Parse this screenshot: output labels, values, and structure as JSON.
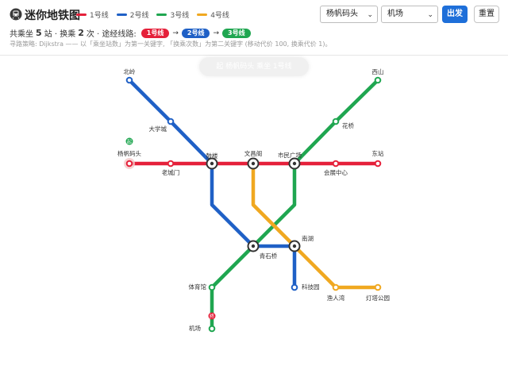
{
  "app": {
    "title": "迷你地铁图",
    "icon": "metro-train-icon"
  },
  "legend": [
    {
      "label": "1号线",
      "color": "#e5203a"
    },
    {
      "label": "2号线",
      "color": "#1f60c6"
    },
    {
      "label": "3号线",
      "color": "#1fa650"
    },
    {
      "label": "4号线",
      "color": "#f0a820"
    }
  ],
  "controls": {
    "from_value": "杨帆码头",
    "to_value": "机场",
    "go_label": "出发",
    "reset_label": "重置",
    "caret_icon": "chevron-down-icon"
  },
  "summary": {
    "prefix": "共乘坐",
    "stops": "5",
    "stops_unit": "站 · 换乘",
    "transfers": "2",
    "transfers_unit": "次 · 途经线路:",
    "route": [
      "1号线",
      "2号线",
      "3号线"
    ],
    "arrow": "→"
  },
  "algo_note": "寻路策略: Dijkstra —— 以「乘坐站数」为第一关键字, 「换乘次数」为第二关键字 (移动代价 100, 换乘代价 1)。",
  "banner": "起 杨帆码头 乘坐 1号线",
  "stations": [
    {
      "id": "beiling",
      "name": "北岭",
      "transfer": false
    },
    {
      "id": "daxuecheng",
      "name": "大学城",
      "transfer": false
    },
    {
      "id": "yangfan",
      "name": "杨帆码头",
      "transfer": false,
      "badge": "起"
    },
    {
      "id": "laochengmen",
      "name": "老城门",
      "transfer": false
    },
    {
      "id": "gulou",
      "name": "鼓楼",
      "transfer": true
    },
    {
      "id": "wenchangge",
      "name": "文昌阁",
      "transfer": true
    },
    {
      "id": "shiminguangchang",
      "name": "市民广场",
      "transfer": true
    },
    {
      "id": "huizhanzhongxin",
      "name": "会展中心",
      "transfer": false
    },
    {
      "id": "dongzhan",
      "name": "东站",
      "transfer": false
    },
    {
      "id": "xishan",
      "name": "西山",
      "transfer": false
    },
    {
      "id": "huaqiao",
      "name": "花桥",
      "transfer": false
    },
    {
      "id": "qingshiqiao",
      "name": "青石桥",
      "transfer": true
    },
    {
      "id": "nanhu",
      "name": "南湖",
      "transfer": true
    },
    {
      "id": "tiyuguan",
      "name": "体育馆",
      "transfer": false
    },
    {
      "id": "jichang",
      "name": "机场",
      "transfer": false,
      "badge": "终"
    },
    {
      "id": "kejiyuan",
      "name": "科技园",
      "transfer": false
    },
    {
      "id": "yurenwan",
      "name": "渔人湾",
      "transfer": false
    },
    {
      "id": "dengtagongyuan",
      "name": "灯塔公园",
      "transfer": false
    }
  ],
  "lines": [
    {
      "name": "1号线",
      "color": "#e5203a",
      "stations": [
        "yangfan",
        "laochengmen",
        "gulou",
        "wenchangge",
        "shiminguangchang",
        "huizhanzhongxin",
        "dongzhan"
      ]
    },
    {
      "name": "2号线",
      "color": "#1f60c6",
      "stations": [
        "beiling",
        "daxuecheng",
        "gulou",
        "qingshiqiao",
        "nanhu",
        "kejiyuan"
      ]
    },
    {
      "name": "3号线",
      "color": "#1fa650",
      "stations": [
        "xishan",
        "huaqiao",
        "shiminguangchang",
        "qingshiqiao",
        "tiyuguan",
        "jichang"
      ]
    },
    {
      "name": "4号线",
      "color": "#f0a820",
      "stations": [
        "wenchangge",
        "nanhu",
        "yurenwan",
        "dengtagongyuan"
      ]
    }
  ]
}
